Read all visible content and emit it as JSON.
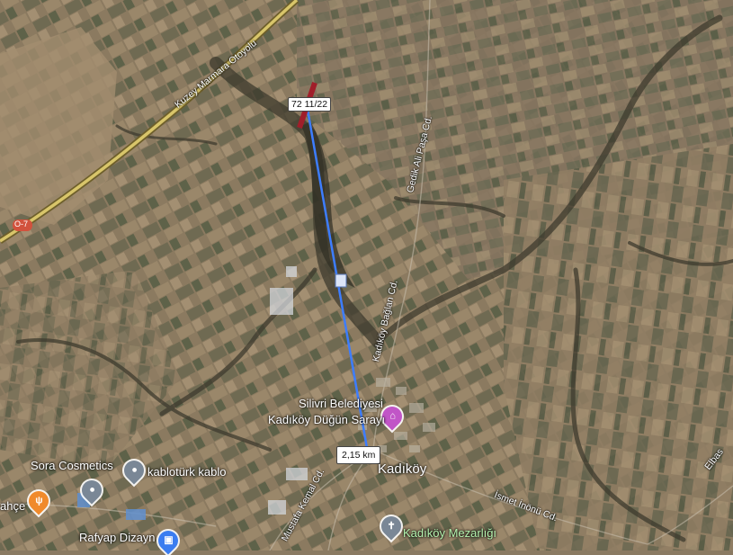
{
  "map": {
    "measurement": {
      "distance_label": "2,15 km",
      "marker_label": "72 11/22",
      "line_color": "#3d7dff",
      "marker_color": "#a01e2a"
    },
    "places": {
      "kadikoy": "Kadıköy",
      "silivri_line1": "Silivri Belediyesi",
      "silivri_line2": "Kadıköy Düğün Sarayı",
      "kablo": "kablotürk kablo",
      "sora": "Sora Cosmetics",
      "rafyap": "Rafyap Dizayn",
      "cemetery": "Kadıköy Mezarlığı",
      "bahce": "ahçe"
    },
    "roads": {
      "motorway": "Kuzey Marmara Otoyolu",
      "motorway_shield": "O-7",
      "gedik": "Gedik Ali Paşa Cd.",
      "baglan": "Kadıköy Bağlan Cd.",
      "ismet": "İsmet İnönü Cd.",
      "mustafa": "Mustafa Kemal Cd.",
      "elbasan": "Elbas"
    },
    "colors": {
      "poi_pink": "#c155c7",
      "poi_grey": "#7a8796",
      "poi_orange": "#f08a2c",
      "poi_blue": "#3b7df0",
      "poi_green_label": "#b6f5b0"
    }
  }
}
